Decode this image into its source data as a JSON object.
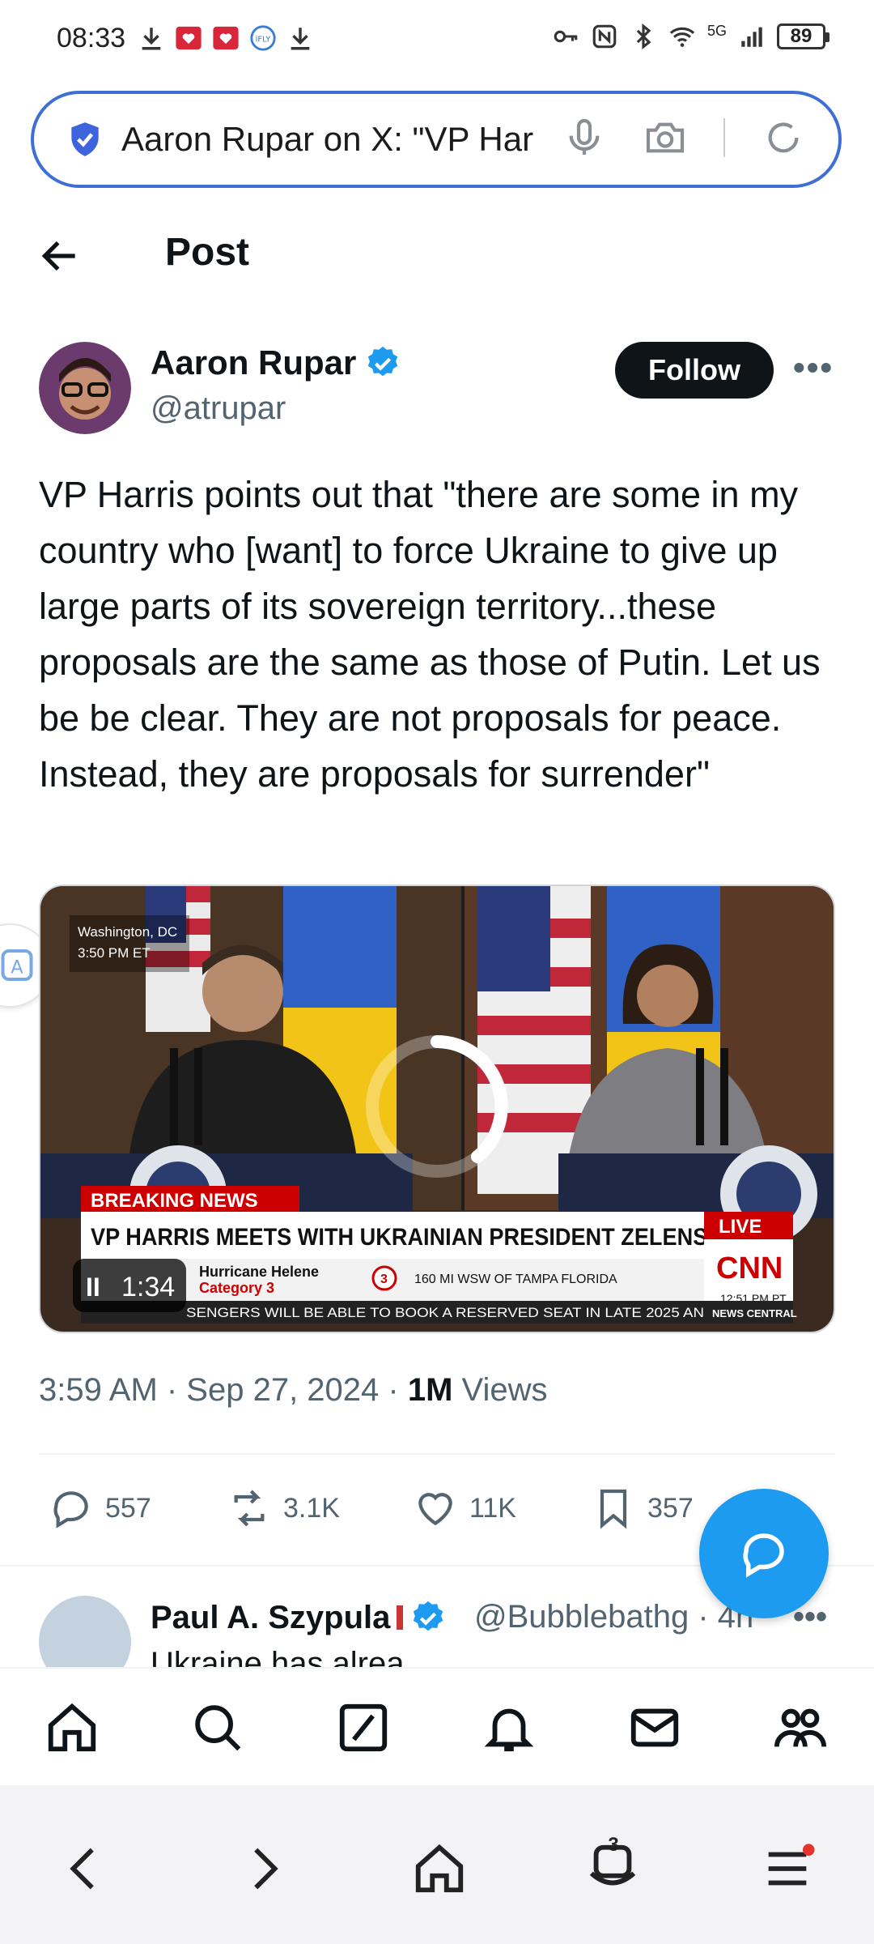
{
  "status_bar": {
    "time": "08:33",
    "network": "5G",
    "battery": "89"
  },
  "url_bar": {
    "text": "Aaron Rupar on X: \"VP Har"
  },
  "header": {
    "title": "Post"
  },
  "post": {
    "author_name": "Aaron Rupar",
    "author_handle": "@atrupar",
    "follow_label": "Follow",
    "more_label": "•••",
    "text": "VP Harris points out that \"there are some in my country who [want] to force Ukraine to give up large parts of its sovereign territory...these proposals are the same as those of Putin. Let us be be clear. They are not proposals for peace. Instead, they are proposals for surrender\"",
    "media": {
      "location_label": "Washington, DC",
      "local_time": "3:50 PM ET",
      "breaking_label": "BREAKING NEWS",
      "headline": "VP HARRIS MEETS WITH UKRAINIAN PRESIDENT ZELENSKY",
      "live_label": "LIVE",
      "network_logo": "CNN",
      "storm_name": "Hurricane Helene",
      "storm_category": "Category 3",
      "storm_number": "3",
      "storm_position": "160 MI WSW OF TAMPA FLORIDA",
      "network_time": "12:51 PM PT",
      "ticker": "SENGERS WILL BE ABLE TO BOOK A RESERVED SEAT IN LATE 2025 AN",
      "ticker_tag": "NEWS CENTRAL",
      "playback_time": "1:34",
      "pause_label": "II"
    },
    "timestamp": "3:59 AM · Sep 27, 2024 · ",
    "views_count": "1M",
    "views_label": " Views",
    "actions": {
      "replies": "557",
      "reposts": "3.1K",
      "likes": "11K",
      "bookmarks": "357"
    }
  },
  "reply": {
    "author_name": "Paul A. Szypula",
    "author_handle": "@Bubblebathg · 4h",
    "text": "Ukraine has alrea",
    "more_label": "•••"
  },
  "browser_nav": {
    "tab_count": "3"
  },
  "colors": {
    "accent": "#1d9bf0",
    "url_border": "#3d6fd6",
    "text_primary": "#0f1419",
    "text_secondary": "#536471",
    "notification_dot": "#e5322d"
  }
}
